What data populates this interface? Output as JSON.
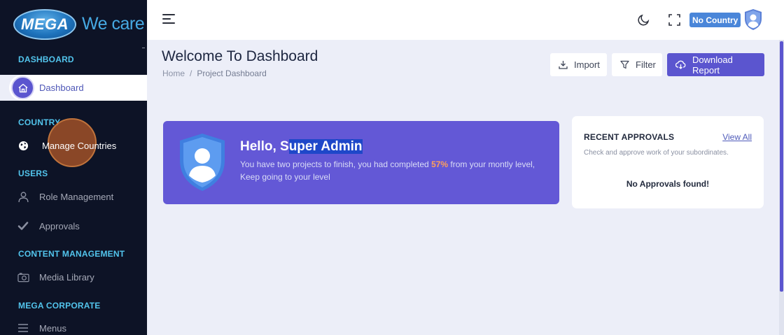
{
  "brand": {
    "logo_text": "MEGA",
    "tagline": "We care"
  },
  "sidebar": {
    "sections": [
      {
        "label": "DASHBOARD"
      },
      {
        "label": "COUNTRY"
      },
      {
        "label": "USERS"
      },
      {
        "label": "CONTENT MANAGEMENT"
      },
      {
        "label": "MEGA CORPORATE"
      }
    ],
    "items": [
      {
        "label": "Dashboard",
        "icon": "home-icon",
        "active": true
      },
      {
        "label": "Manage Countries",
        "icon": "globe-icon"
      },
      {
        "label": "Role Management",
        "icon": "user-icon"
      },
      {
        "label": "Approvals",
        "icon": "check-icon"
      },
      {
        "label": "Media Library",
        "icon": "camera-icon"
      },
      {
        "label": "Menus",
        "icon": "menu-icon"
      }
    ]
  },
  "topbar": {
    "country_badge": "No Country",
    "icons": [
      "hamburger-icon",
      "moon-icon",
      "fullscreen-icon",
      "avatar-shield-icon"
    ]
  },
  "page": {
    "title": "Welcome To Dashboard",
    "breadcrumb": {
      "home": "Home",
      "separator": "/",
      "current": "Project Dashboard"
    }
  },
  "actions": {
    "import_label": "Import",
    "filter_label": "Filter",
    "download_label": "Download Report"
  },
  "welcome_card": {
    "greeting_prefix": "Hello, S",
    "greeting_highlight": "uper Admin",
    "text_before": "You have two projects to finish, you had completed ",
    "percent": "57%",
    "text_after": " from your montly level, Keep going to your level"
  },
  "approvals": {
    "title": "RECENT APPROVALS",
    "view_all": "View All",
    "subtitle": "Check and approve work of your subordinates.",
    "empty": "No Approvals found!"
  },
  "colors": {
    "sidebar_bg": "#0d1326",
    "section_label": "#52c4ec",
    "primary": "#5b55cf",
    "card_bg": "#6358d6",
    "accent_percent": "#ff9f5a",
    "page_bg": "#eceef8"
  }
}
